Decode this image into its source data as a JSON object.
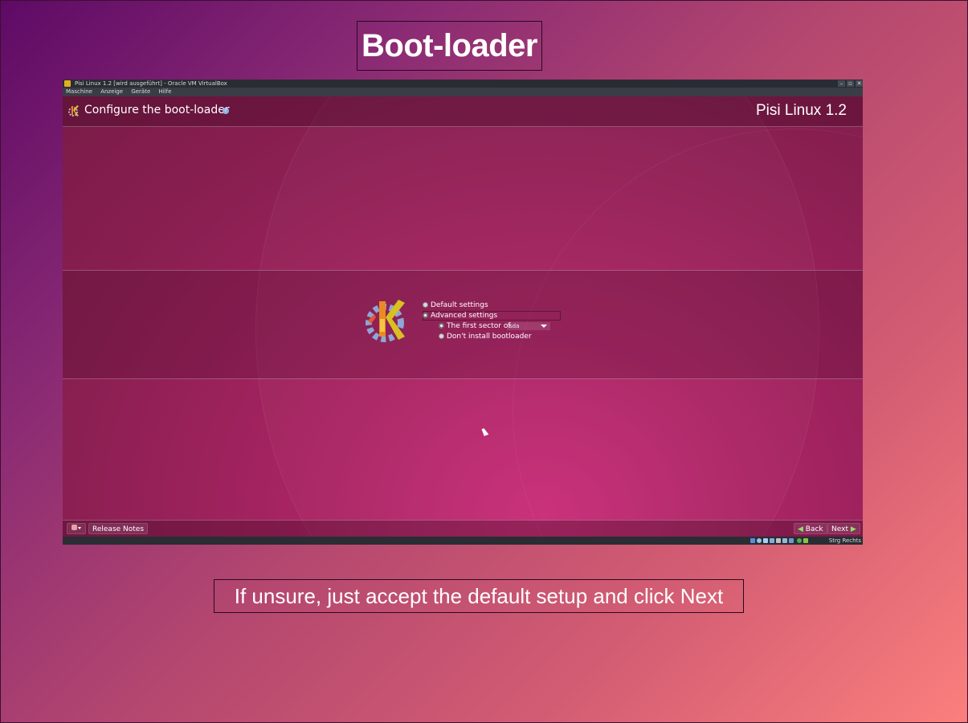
{
  "slide": {
    "title": "Boot-loader",
    "caption": "If unsure, just accept the default setup and click Next"
  },
  "vm_window": {
    "title": "Pisi Linux 1.2 [wird ausgeführt] - Oracle VM VirtualBox",
    "menu": [
      "Maschine",
      "Anzeige",
      "Geräte",
      "Hilfe"
    ],
    "window_buttons": {
      "minimize": "–",
      "restore": "▫",
      "close": "✕"
    },
    "status_host_key": "Strg Rechts"
  },
  "installer": {
    "header_title": "Configure the boot-loader",
    "help_icon": "?",
    "brand": "Pisi Linux 1.2",
    "options": {
      "default": "Default settings",
      "advanced": "Advanced settings",
      "first_sector": "The first sector of",
      "first_sector_value": "sda",
      "dont_install": "Don't install bootloader"
    },
    "selected_option": "Advanced settings",
    "footer": {
      "release_notes": "Release Notes",
      "back": "Back",
      "next": "Next",
      "back_icon": "◀",
      "next_icon": "▶"
    }
  },
  "colors": {
    "accent": "#c92e78",
    "vm_chrome": "#2a2c33"
  }
}
